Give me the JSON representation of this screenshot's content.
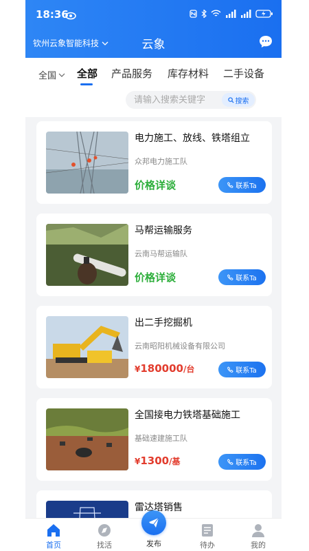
{
  "status_bar": {
    "time": "18:36"
  },
  "header": {
    "company": "钦州云象智能科技",
    "title": "云象"
  },
  "filters": {
    "region": "全国",
    "tabs": [
      "全部",
      "产品服务",
      "库存材料",
      "二手设备"
    ]
  },
  "search": {
    "placeholder": "请输入搜索关键字",
    "button_label": "搜索"
  },
  "listings": [
    {
      "title": "电力施工、放线、铁塔组立",
      "org": "众邦电力施工队",
      "price": "价格详谈",
      "contact": "联系Ta"
    },
    {
      "title": "马帮运输服务",
      "org": "云南马帮运输队",
      "price": "价格详谈",
      "contact": "联系Ta"
    },
    {
      "title": "出二手挖掘机",
      "org": "云南昭阳机械设备有限公司",
      "price_currency": "¥",
      "price_amount": "180000",
      "price_unit": "/台",
      "contact": "联系Ta"
    },
    {
      "title": "全国接电力铁塔基础施工",
      "org": "基础速建施工队",
      "price_currency": "¥",
      "price_amount": "1300",
      "price_unit": "/基",
      "contact": "联系Ta"
    },
    {
      "title": "雷达塔销售"
    }
  ],
  "tabbar": {
    "items": [
      "首页",
      "找活",
      "发布",
      "待办",
      "我的"
    ],
    "active": "首页"
  },
  "colors": {
    "primary": "#1a6ff0",
    "price_green": "#2cae3a",
    "price_red": "#e23c2d"
  }
}
